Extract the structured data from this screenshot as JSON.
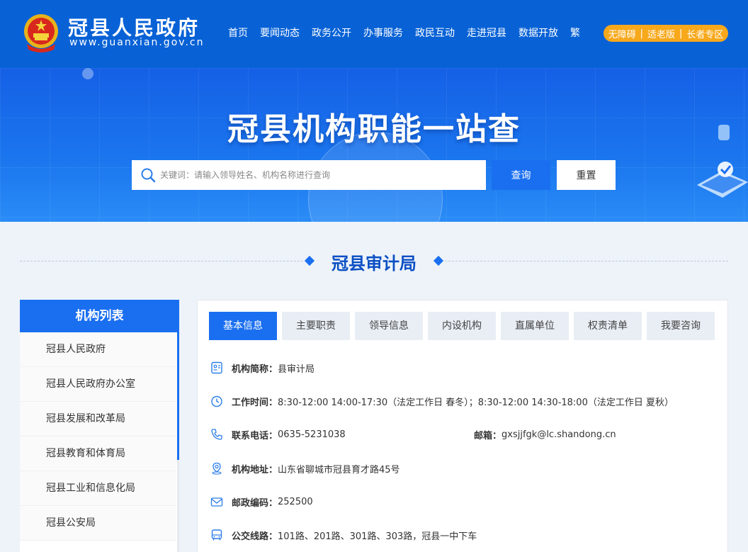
{
  "header": {
    "site_name": "冠县人民政府",
    "site_url": "www.guanxian.gov.cn",
    "nav": [
      "首页",
      "要闻动态",
      "政务公开",
      "办事服务",
      "政民互动",
      "走进冠县",
      "数据开放"
    ],
    "traditional": "繁",
    "accessibility": [
      "无障碍",
      "适老版",
      "长者专区"
    ],
    "accessibility_sep": "|"
  },
  "banner": {
    "title": "冠县机构职能一站查",
    "search_placeholder": "关键词：请输入领导姓名、机构名称进行查询",
    "query_button": "查询",
    "reset_button": "重置"
  },
  "section_title": "冠县审计局",
  "sidebar": {
    "title": "机构列表",
    "items": [
      "冠县人民政府",
      "冠县人民政府办公室",
      "冠县发展和改革局",
      "冠县教育和体育局",
      "冠县工业和信息化局",
      "冠县公安局"
    ]
  },
  "tabs": [
    "基本信息",
    "主要职责",
    "领导信息",
    "内设机构",
    "直属单位",
    "权责清单",
    "我要咨询"
  ],
  "info": {
    "short_name_label": "机构简称：",
    "short_name": "县审计局",
    "hours_label": "工作时间：",
    "hours": "8:30-12:00 14:00-17:30（法定工作日 春冬）；8:30-12:00 14:30-18:00（法定工作日 夏秋）",
    "phone_label": "联系电话：",
    "phone": "0635-5231038",
    "email_label": "邮箱：",
    "email": "gxsjjfgk@lc.shandong.cn",
    "address_label": "机构地址：",
    "address": "山东省聊城市冠县育才路45号",
    "postcode_label": "邮政编码：",
    "postcode": "252500",
    "bus_label": "公交线路：",
    "bus": "101路、201路、301路、303路，冠县一中下车"
  },
  "colors": {
    "brand_blue": "#0862d6",
    "accent_blue": "#1a6ff0",
    "accessibility_orange": "#f7a81b"
  }
}
